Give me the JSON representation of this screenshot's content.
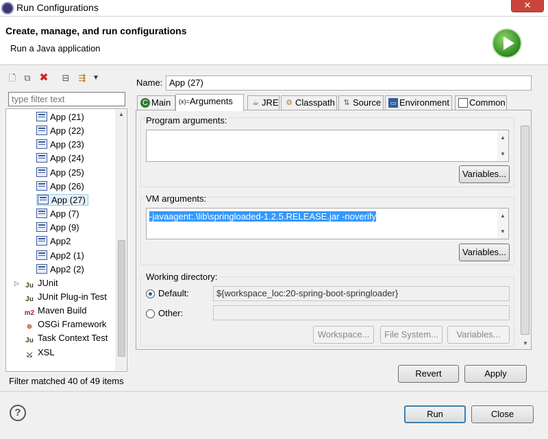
{
  "window": {
    "title": "Run Configurations",
    "close_label": "✕"
  },
  "header": {
    "title": "Create, manage, and run configurations",
    "subtitle": "Run a Java application"
  },
  "left": {
    "filter_placeholder": "type filter text",
    "tree": [
      {
        "label": "App (21)",
        "icon": "java-app-icon"
      },
      {
        "label": "App (22)",
        "icon": "java-app-icon"
      },
      {
        "label": "App (23)",
        "icon": "java-app-icon"
      },
      {
        "label": "App (24)",
        "icon": "java-app-icon"
      },
      {
        "label": "App (25)",
        "icon": "java-app-icon"
      },
      {
        "label": "App (26)",
        "icon": "java-app-icon"
      },
      {
        "label": "App (27)",
        "icon": "java-app-icon",
        "selected": true
      },
      {
        "label": "App (7)",
        "icon": "java-app-icon"
      },
      {
        "label": "App (9)",
        "icon": "java-app-icon"
      },
      {
        "label": "App2",
        "icon": "java-app-icon"
      },
      {
        "label": "App2 (1)",
        "icon": "java-app-icon"
      },
      {
        "label": "App2 (2)",
        "icon": "java-app-icon"
      },
      {
        "label": "JUnit",
        "icon": "junit-icon",
        "expandable": true
      },
      {
        "label": "JUnit Plug-in Test",
        "icon": "junit-plugin-icon"
      },
      {
        "label": "Maven Build",
        "icon": "maven-icon"
      },
      {
        "label": "OSGi Framework",
        "icon": "osgi-icon"
      },
      {
        "label": "Task Context Test",
        "icon": "task-context-icon"
      },
      {
        "label": "XSL",
        "icon": "xsl-icon"
      }
    ],
    "filter_status": "Filter matched 40 of 49 items"
  },
  "name": {
    "label": "Name:",
    "value": "App (27)"
  },
  "tabs": [
    {
      "label": "Main",
      "icon": "main-tab-icon"
    },
    {
      "label": "Arguments",
      "icon": "arguments-tab-icon",
      "active": true
    },
    {
      "label": "JRE",
      "icon": "jre-tab-icon"
    },
    {
      "label": "Classpath",
      "icon": "classpath-tab-icon"
    },
    {
      "label": "Source",
      "icon": "source-tab-icon"
    },
    {
      "label": "Environment",
      "icon": "environment-tab-icon"
    },
    {
      "label": "Common",
      "icon": "common-tab-icon"
    }
  ],
  "program_args": {
    "label": "Program arguments:",
    "value": "",
    "variables_label": "Variables..."
  },
  "vm_args": {
    "label": "VM arguments:",
    "value": "-javaagent:.\\lib\\springloaded-1.2.5.RELEASE.jar -noverify",
    "variables_label": "Variables..."
  },
  "working_dir": {
    "label": "Working directory:",
    "default_label": "Default:",
    "default_value": "${workspace_loc:20-spring-boot-springloader}",
    "other_label": "Other:",
    "other_value": "",
    "workspace_label": "Workspace...",
    "filesystem_label": "File System...",
    "variables_label": "Variables..."
  },
  "actions": {
    "revert": "Revert",
    "apply": "Apply",
    "run": "Run",
    "close": "Close",
    "help": "?"
  }
}
